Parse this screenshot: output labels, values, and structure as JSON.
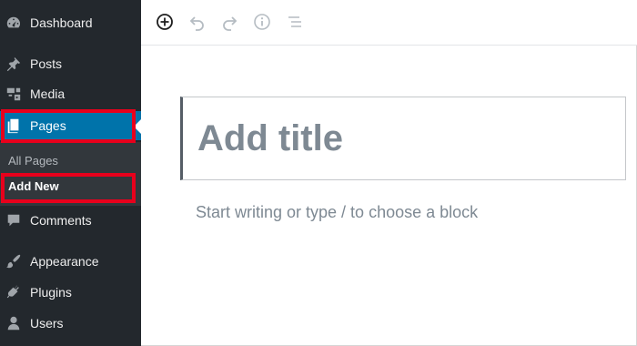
{
  "sidebar": {
    "items": [
      {
        "label": "Dashboard",
        "icon": "dashboard-icon"
      },
      {
        "label": "Posts",
        "icon": "pin-icon"
      },
      {
        "label": "Media",
        "icon": "media-icon"
      },
      {
        "label": "Pages",
        "icon": "pages-icon"
      },
      {
        "label": "Comments",
        "icon": "comment-icon"
      },
      {
        "label": "Appearance",
        "icon": "paintbrush-icon"
      },
      {
        "label": "Plugins",
        "icon": "plug-icon"
      },
      {
        "label": "Users",
        "icon": "user-icon"
      }
    ],
    "submenu": {
      "all_pages": "All Pages",
      "add_new": "Add New"
    }
  },
  "toolbar": {
    "icons": [
      "add-block-icon",
      "undo-icon",
      "redo-icon",
      "info-icon",
      "outline-icon"
    ]
  },
  "editor": {
    "title_placeholder": "Add title",
    "block_placeholder": "Start writing or type / to choose a block"
  },
  "colors": {
    "sidebar_bg": "#23282d",
    "submenu_bg": "#32373c",
    "active_bg": "#0073aa",
    "highlight": "#e8001c"
  }
}
